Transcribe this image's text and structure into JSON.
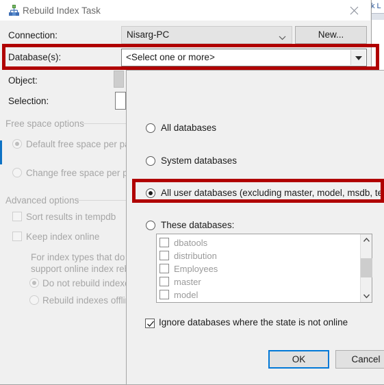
{
  "window": {
    "title": "Rebuild Index Task",
    "icon": "rebuild-index-icon",
    "close_label": "×"
  },
  "background_window": {
    "tab_fragment": "k L"
  },
  "form": {
    "connection": {
      "label": "Connection:",
      "value": "Nisarg-PC",
      "new_button": "New..."
    },
    "databases": {
      "label": "Database(s):",
      "value": "<Select one or more>",
      "placeholder": "<Select one or more>"
    },
    "object": {
      "label": "Object:"
    },
    "selection": {
      "label": "Selection:"
    },
    "free_space_group": {
      "title": "Free space options",
      "options": [
        {
          "label": "Default free space per page",
          "selected": true
        },
        {
          "label": "Change free space per page",
          "selected": false
        }
      ]
    },
    "advanced_group": {
      "title": "Advanced options",
      "checkboxes": [
        {
          "label": "Sort results in tempdb",
          "checked": false
        },
        {
          "label": "Keep index online",
          "checked": false
        }
      ],
      "note_line1": "For index types that do not",
      "note_line2": "support online index rebuil",
      "sub_options": [
        {
          "label": "Do not rebuild indexes",
          "selected": true
        },
        {
          "label": "Rebuild indexes offline",
          "selected": false
        }
      ]
    }
  },
  "dropdown": {
    "options": [
      {
        "label": "All databases",
        "selected": false
      },
      {
        "label": "System databases",
        "selected": false
      },
      {
        "label": "All user databases  (excluding master, model, msdb, tempdb)",
        "selected": true
      },
      {
        "label": "These databases:",
        "selected": false
      }
    ],
    "database_list": [
      {
        "name": "dbatools",
        "checked": false
      },
      {
        "name": "distribution",
        "checked": false
      },
      {
        "name": "Employees",
        "checked": false
      },
      {
        "name": "master",
        "checked": false
      },
      {
        "name": "model",
        "checked": false
      }
    ],
    "ignore_offline": {
      "label": "Ignore databases where the state is not online",
      "checked": true
    },
    "ok_label": "OK",
    "cancel_label": "Cancel"
  },
  "annotations": {
    "highlight_color": "#b00000",
    "boxes": [
      {
        "name": "databases-row-highlight"
      },
      {
        "name": "all-user-databases-highlight"
      }
    ]
  },
  "colors": {
    "accent": "#0078d7",
    "dialog_bg": "#f0f0f0",
    "highlight": "#b00000",
    "sidebar_accent": "#0e72c4"
  }
}
